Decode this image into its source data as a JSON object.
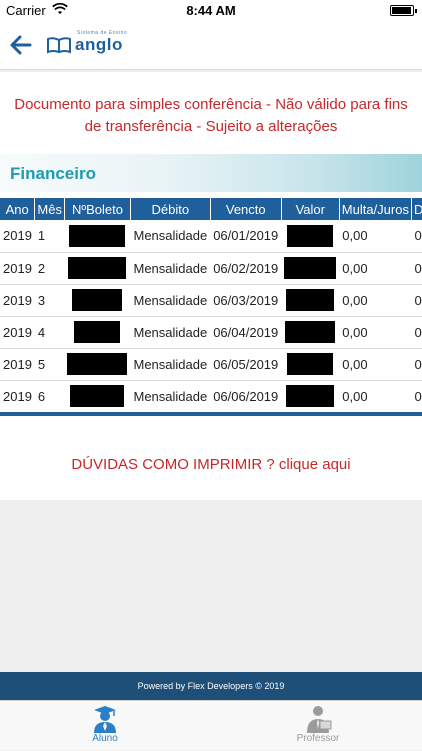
{
  "status_bar": {
    "carrier": "Carrier",
    "time": "8:44 AM"
  },
  "nav": {
    "back_icon": "arrow-left-icon",
    "logo_text": "anglo",
    "logo_subtext": "Sistema de Ensino"
  },
  "notice": "Documento para simples conferência - Não válido para fins de transferência - Sujeito a alterações",
  "section": {
    "title": "Financeiro"
  },
  "table": {
    "headers": [
      "Ano",
      "Mês",
      "NºBoleto",
      "Débito",
      "Vencto",
      "Valor",
      "Multa/Juros",
      "D"
    ],
    "rows": [
      {
        "ano": "2019",
        "mes": "1",
        "debito": "Mensalidade",
        "vencto": "06/01/2019",
        "multa": "0,00",
        "d": "0"
      },
      {
        "ano": "2019",
        "mes": "2",
        "debito": "Mensalidade",
        "vencto": "06/02/2019",
        "multa": "0,00",
        "d": "0"
      },
      {
        "ano": "2019",
        "mes": "3",
        "debito": "Mensalidade",
        "vencto": "06/03/2019",
        "multa": "0,00",
        "d": "0"
      },
      {
        "ano": "2019",
        "mes": "4",
        "debito": "Mensalidade",
        "vencto": "06/04/2019",
        "multa": "0,00",
        "d": "0"
      },
      {
        "ano": "2019",
        "mes": "5",
        "debito": "Mensalidade",
        "vencto": "06/05/2019",
        "multa": "0,00",
        "d": "0"
      },
      {
        "ano": "2019",
        "mes": "6",
        "debito": "Mensalidade",
        "vencto": "06/06/2019",
        "multa": "0,00",
        "d": "0"
      }
    ]
  },
  "help_link": "DÚVIDAS COMO IMPRIMIR ? clique aqui",
  "footer": "Powered by Flex Developers © 2019",
  "tabs": [
    {
      "label": "Aluno",
      "icon": "student-icon",
      "active": true
    },
    {
      "label": "Professor",
      "icon": "teacher-icon",
      "active": false
    }
  ],
  "colors": {
    "brand_blue": "#1f5f9b",
    "alert_red": "#c6282b",
    "section_teal": "#1d9bb0",
    "footer_blue": "#1d4f79",
    "tab_active": "#2b7fc7"
  }
}
